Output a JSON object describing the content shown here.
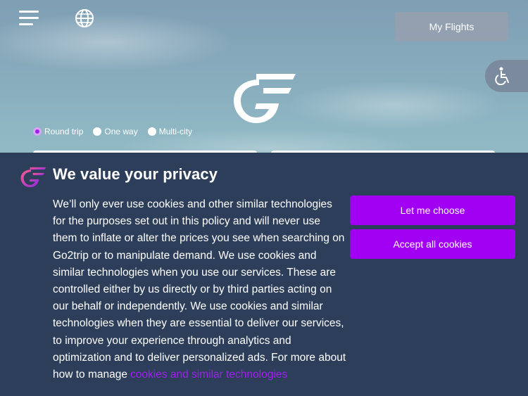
{
  "header": {
    "menu_icon": "hamburger-menu-icon",
    "language_icon": "globe-icon",
    "my_flights_label": "My Flights",
    "accessibility_icon": "wheelchair-icon"
  },
  "search": {
    "trip_types": [
      {
        "label": "Round trip",
        "selected": true
      },
      {
        "label": "One way",
        "selected": false
      },
      {
        "label": "Multi-city",
        "selected": false
      }
    ]
  },
  "privacy": {
    "title": "We value your privacy",
    "body": "We’ll only ever use cookies and other similar technologies for the purposes set out in this policy and will never use them to inflate or alter the prices you see when searching on Go2trip or to manipulate demand. We use cookies and similar technologies when you use our services. These are controlled either by us directly or by third parties acting on our behalf or independently. We use cookies and similar technologies when they are essential to deliver our services, to improve your experience through analytics and optimization and to deliver personalized ads. For more about how to manage",
    "link_text": "cookies and similar technologies",
    "let_me_choose_label": "Let me choose",
    "accept_all_label": "Accept all cookies"
  },
  "colors": {
    "accent": "#a100f2",
    "banner_bg": "#2c3e59",
    "my_flights_bg": "#96a0af"
  }
}
